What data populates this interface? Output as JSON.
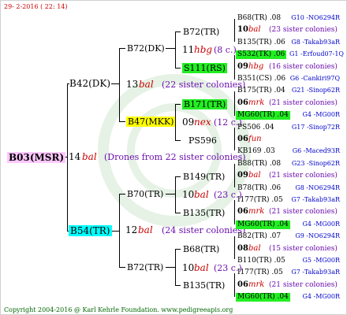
{
  "header": {
    "date": "29-  2-2016 ( 22: 14)"
  },
  "footer": {
    "text": "Copyright 2004-2016 @ Karl Kehrle Foundation.   www.pedigreeapis.org"
  },
  "root": {
    "id": "B03(MSR)",
    "year": "14",
    "name": "bal",
    "note": "(Drones from 22 sister colonies)"
  },
  "parents": {
    "drone_side": {
      "id": "B42(DK)"
    },
    "queen_side": {
      "id": "B54(TR)",
      "year": "12",
      "name": "bal",
      "note": "(24 sister colonies)"
    }
  },
  "gen2": {
    "b72dk": {
      "id": "B72(DK)"
    },
    "g13": {
      "year": "13",
      "name": "bal",
      "note": "(22 sister colonies)"
    },
    "b47": {
      "id": "B47(MKK)"
    },
    "b70": {
      "id": "B70(TR)"
    },
    "b72tr": {
      "id": "B72(TR)"
    }
  },
  "gen3": {
    "b72tr_top": {
      "id": "B72(TR)"
    },
    "g11": {
      "year": "11",
      "name": "hbg",
      "note": "(8 c.)"
    },
    "s111": {
      "id": "S111(RS)"
    },
    "b171": {
      "id": "B171(TR)"
    },
    "g09": {
      "year": "09",
      "name": "nex",
      "note": "(12 c.)"
    },
    "ps596": {
      "id": "PS596"
    },
    "b149": {
      "id": "B149(TR)"
    },
    "g10a": {
      "year": "10",
      "name": "bal",
      "note": "(23 c.)"
    },
    "b135a": {
      "id": "B135(TR)"
    },
    "b68": {
      "id": "B68(TR)"
    },
    "g10b": {
      "year": "10",
      "name": "bal",
      "note": "(23 c.)"
    },
    "b135b": {
      "id": "B135(TR)"
    }
  },
  "gen4": [
    {
      "id": "B68(TR) .08",
      "src": "G10 -NO6294R"
    },
    {
      "year": "10",
      "name": "bal",
      "note": "(23 sister colonies)"
    },
    {
      "id": "B135(TR) .06",
      "src": "G8 -Takab93aR"
    },
    {
      "id": "S532(TK) .06",
      "src": "G1 -Erfoud07-1Q"
    },
    {
      "year": "09",
      "name": "hbg",
      "note": "(16 sister colonies)"
    },
    {
      "id": "B351(CS) .06",
      "src": "G6 -Cankiri97Q"
    },
    {
      "id": "B175(TR) .04",
      "src": "G21 -Sinop62R"
    },
    {
      "year": "06",
      "name": "mrk",
      "note": "(21 sister colonies)"
    },
    {
      "id": "MG60(TR) .04",
      "src": "G4 -MG00R"
    },
    {
      "id": "PS506 .04",
      "src": "G17 -Sinop72R"
    },
    {
      "year": "06",
      "name": "fun",
      "note": ""
    },
    {
      "id": "KB169 .03",
      "src": "G6 -Maced93R"
    },
    {
      "id": "B88(TR) .08",
      "src": "G23 -Sinop62R"
    },
    {
      "year": "09",
      "name": "bal",
      "note": "(21 sister colonies)"
    },
    {
      "id": "B78(TR) .06",
      "src": "G8 -NO6294R"
    },
    {
      "id": "I177(TR) .05",
      "src": "G7 -Takab93aR"
    },
    {
      "year": "06",
      "name": "mrk",
      "note": "(21 sister colonies)"
    },
    {
      "id": "MG60(TR) .04",
      "src": "G4 -MG00R"
    },
    {
      "id": "B82(TR) .07",
      "src": "G9 -NO6294R"
    },
    {
      "year": "08",
      "name": "bal",
      "note": "(15 sister colonies)"
    },
    {
      "id": "B110(TR) .05",
      "src": "G5 -MG00R"
    },
    {
      "id": "I177(TR) .05",
      "src": "G7 -Takab93aR"
    },
    {
      "year": "06",
      "name": "mrk",
      "note": "(21 sister colonies)"
    },
    {
      "id": "MG60(TR) .04",
      "src": "G4 -MG00R"
    }
  ]
}
